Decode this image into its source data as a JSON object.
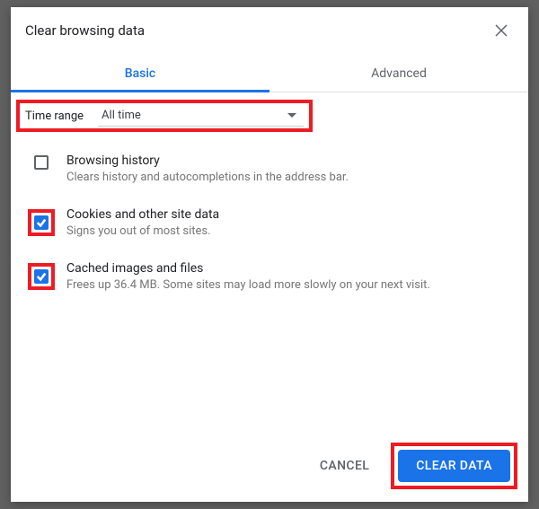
{
  "dialog": {
    "title": "Clear browsing data"
  },
  "tabs": {
    "basic": "Basic",
    "advanced": "Advanced"
  },
  "timeRange": {
    "label": "Time range",
    "value": "All time"
  },
  "options": {
    "browsingHistory": {
      "title": "Browsing history",
      "desc": "Clears history and autocompletions in the address bar.",
      "checked": false
    },
    "cookies": {
      "title": "Cookies and other site data",
      "desc": "Signs you out of most sites.",
      "checked": true
    },
    "cache": {
      "title": "Cached images and files",
      "desc": "Frees up 36.4 MB. Some sites may load more slowly on your next visit.",
      "checked": true
    }
  },
  "footer": {
    "cancel": "CANCEL",
    "clear": "CLEAR DATA"
  }
}
